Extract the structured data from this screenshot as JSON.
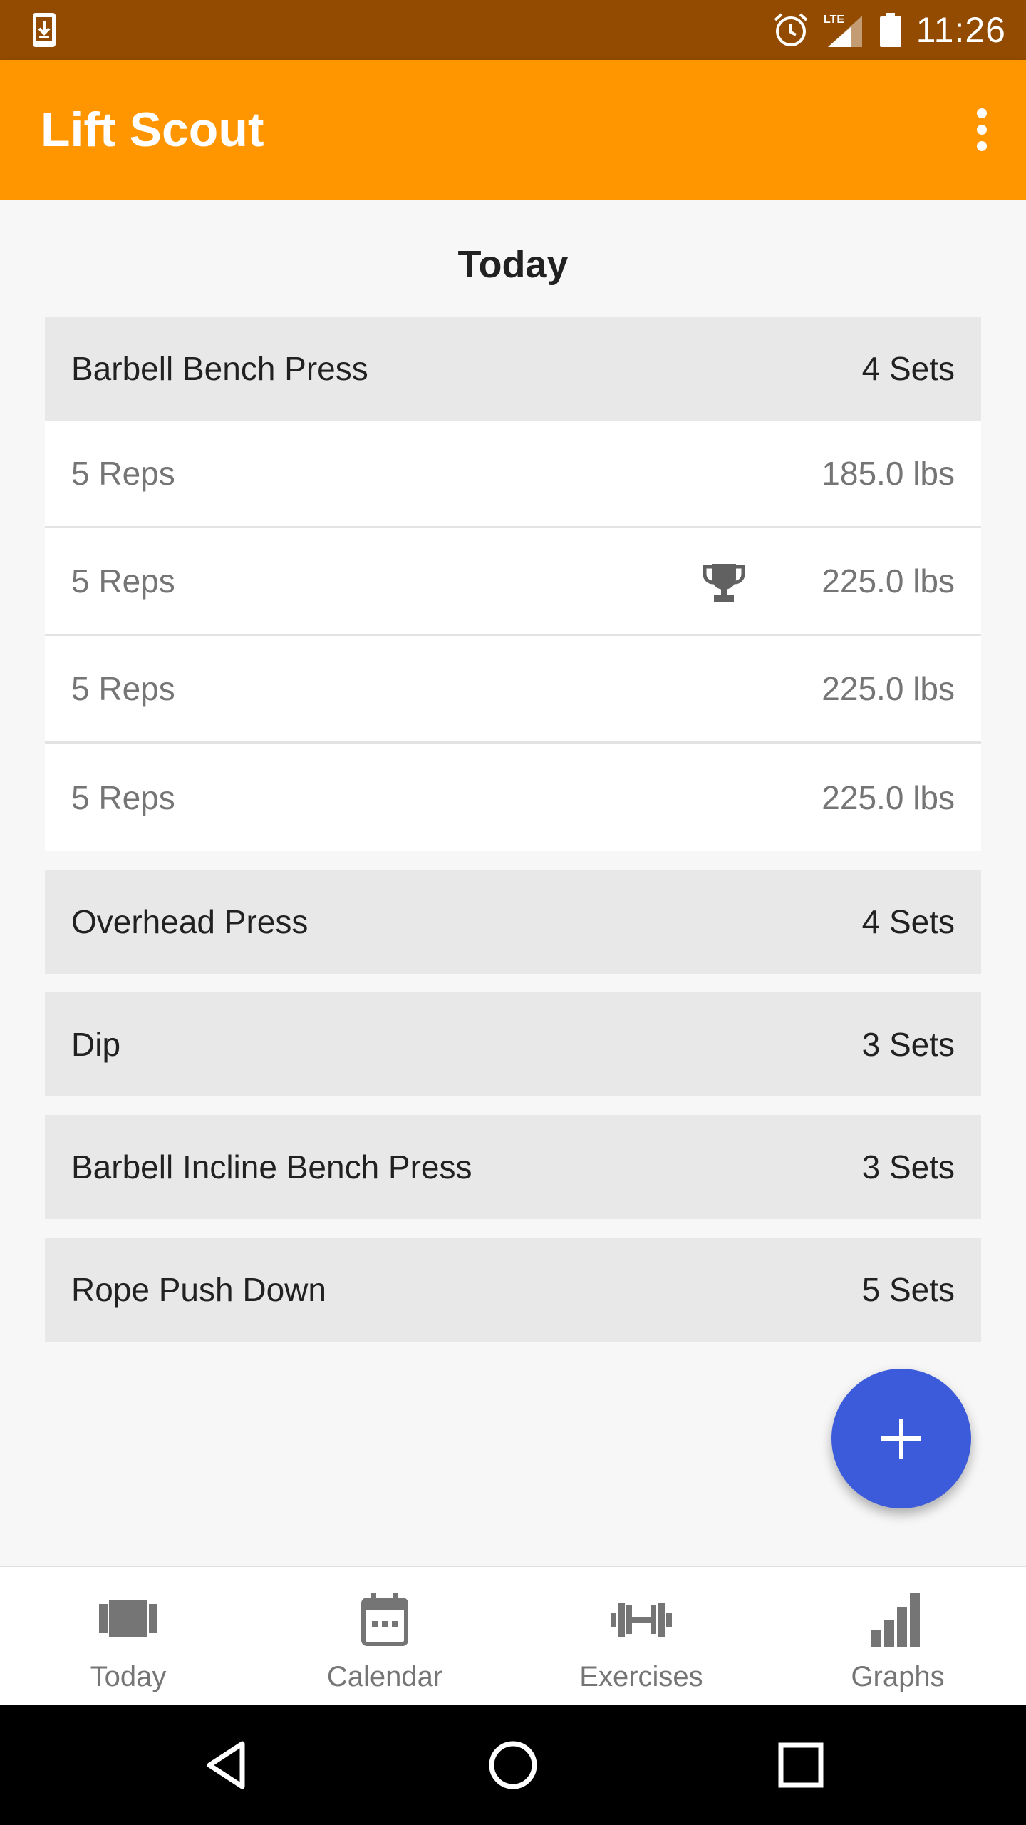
{
  "status_bar": {
    "time": "11:26",
    "network": "LTE",
    "icons": [
      "download-icon",
      "alarm-icon",
      "signal-icon",
      "battery-icon"
    ]
  },
  "app_bar": {
    "title": "Lift Scout",
    "menu_icon": "overflow-menu-icon"
  },
  "main": {
    "day_title": "Today",
    "exercises": [
      {
        "name": "Barbell Bench Press",
        "sets_label": "4 Sets",
        "sets": [
          {
            "reps": "5 Reps",
            "weight": "185.0 lbs",
            "trophy": false
          },
          {
            "reps": "5 Reps",
            "weight": "225.0 lbs",
            "trophy": true
          },
          {
            "reps": "5 Reps",
            "weight": "225.0 lbs",
            "trophy": false
          },
          {
            "reps": "5 Reps",
            "weight": "225.0 lbs",
            "trophy": false
          }
        ]
      },
      {
        "name": "Overhead Press",
        "sets_label": "4 Sets"
      },
      {
        "name": "Dip",
        "sets_label": "3 Sets"
      },
      {
        "name": "Barbell Incline Bench Press",
        "sets_label": "3 Sets"
      },
      {
        "name": "Rope Push Down",
        "sets_label": "5 Sets"
      }
    ],
    "fab_icon": "plus-icon"
  },
  "bottom_nav": {
    "items": [
      {
        "label": "Today",
        "icon": "today-icon"
      },
      {
        "label": "Calendar",
        "icon": "calendar-icon"
      },
      {
        "label": "Exercises",
        "icon": "dumbbell-icon"
      },
      {
        "label": "Graphs",
        "icon": "bar-chart-icon"
      }
    ]
  },
  "system_nav": {
    "icons": [
      "back-icon",
      "home-icon",
      "recents-icon"
    ]
  },
  "colors": {
    "status_bar": "#924b00",
    "app_bar": "#ff9600",
    "fab": "#3b5bdb",
    "exercise_header": "#e8e8e8",
    "set_row": "#ffffff"
  }
}
